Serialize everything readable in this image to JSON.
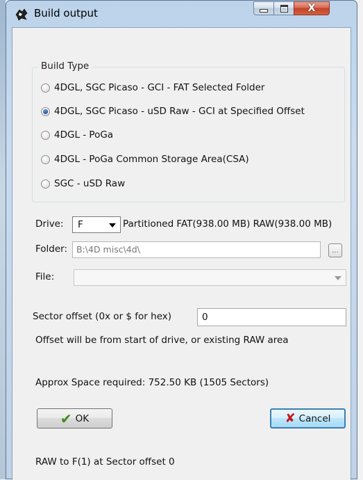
{
  "window": {
    "title": "Build output",
    "icon": "4d-app-icon"
  },
  "titlebar_buttons": {
    "minimize": "minimize-icon",
    "maximize": "maximize-icon",
    "close": "close-icon",
    "close_glyph": "X"
  },
  "build_type": {
    "legend": "Build Type",
    "options": [
      {
        "label": "4DGL, SGC Picaso - GCI - FAT Selected Folder",
        "checked": false
      },
      {
        "label": "4DGL, SGC Picaso - uSD Raw - GCI at Specified Offset",
        "checked": true
      },
      {
        "label": "4DGL - PoGa",
        "checked": false
      },
      {
        "label": "4DGL - PoGa Common Storage Area(CSA)",
        "checked": false
      },
      {
        "label": "SGC - uSD Raw",
        "checked": false
      }
    ]
  },
  "drive": {
    "label": "Drive:",
    "value": "F",
    "info": "Partitioned FAT(938.00 MB) RAW(938.00 MB)"
  },
  "folder": {
    "label": "Folder:",
    "value": "B:\\4D misc\\4d\\",
    "browse": "..."
  },
  "file": {
    "label": "File:",
    "value": ""
  },
  "sector": {
    "label": "Sector offset (0x or $ for hex)",
    "value": "0",
    "note": "Offset will be from start of drive, or existing RAW area"
  },
  "space": "Approx Space required: 752.50 KB (1505 Sectors)",
  "buttons": {
    "ok": "OK",
    "cancel": "Cancel"
  },
  "status": "RAW to F(1) at Sector offset 0",
  "colors": {
    "accent": "#3c7fb1",
    "titlebar": "#bcd3ea",
    "close": "#c4422a"
  }
}
